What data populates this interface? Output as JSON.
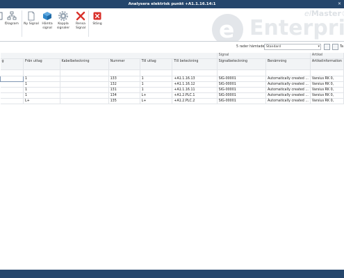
{
  "window": {
    "title": "Analysera elektrisk punkt +A1.1.16.14:1"
  },
  "ribbon": {
    "partial_left": "t",
    "diagram": "Diagram",
    "ny_signal": "Ny Signal",
    "hamta_signal": [
      "Hämta",
      "signal"
    ],
    "koppla_signaler": [
      "Koppla",
      "signaler"
    ],
    "rensa_signal": [
      "Rensa",
      "Signal"
    ],
    "stang": "Stäng"
  },
  "brand": {
    "e": "e",
    "name": "Enterprise",
    "sup_prefix": "el",
    "sup_bold": "Master",
    "sup_mark": "®"
  },
  "filter": {
    "label": "5 rader hämtade",
    "value": "Standard",
    "tb_partial": "Ta"
  },
  "grid": {
    "groups": {
      "signal": "Signal",
      "artikel": "Artikel"
    },
    "columns": [
      "g",
      "Från uttag",
      "Kabelbeteckning",
      "Nummer",
      "Till uttag",
      "Till beteckning",
      "Signalbeteckning",
      "Benämning",
      "Artikelinformation"
    ],
    "rows": [
      [
        "",
        "1",
        "",
        "133",
        "1",
        "+A1.1.16.13",
        "SIG-00001",
        "Automatically created ...",
        "Varsius RK 0,"
      ],
      [
        "",
        "1",
        "",
        "132",
        "1",
        "+A1.1.16.12",
        "SIG-00001",
        "Automatically created ...",
        "Varsius RK 0,"
      ],
      [
        "",
        "1",
        "",
        "131",
        "1",
        "+A1.1.16.11",
        "SIG-00001",
        "Automatically created ...",
        "Varsius RK 0,"
      ],
      [
        "",
        "1",
        "",
        "134",
        "L+",
        "+A1.2.PLC.1",
        "SIG-00001",
        "Automatically created ...",
        "Varsius RK 0,"
      ],
      [
        "",
        "L+",
        "",
        "135",
        "L+",
        "+A1.2.PLC.2",
        "SIG-00001",
        "Automatically created ...",
        "Varsius RK 0,"
      ]
    ]
  },
  "colors": {
    "titlebar": "#25466c",
    "statusbar": "#25466c",
    "close_red": "#d9312b",
    "hamta_blue": "#2e86c9"
  }
}
